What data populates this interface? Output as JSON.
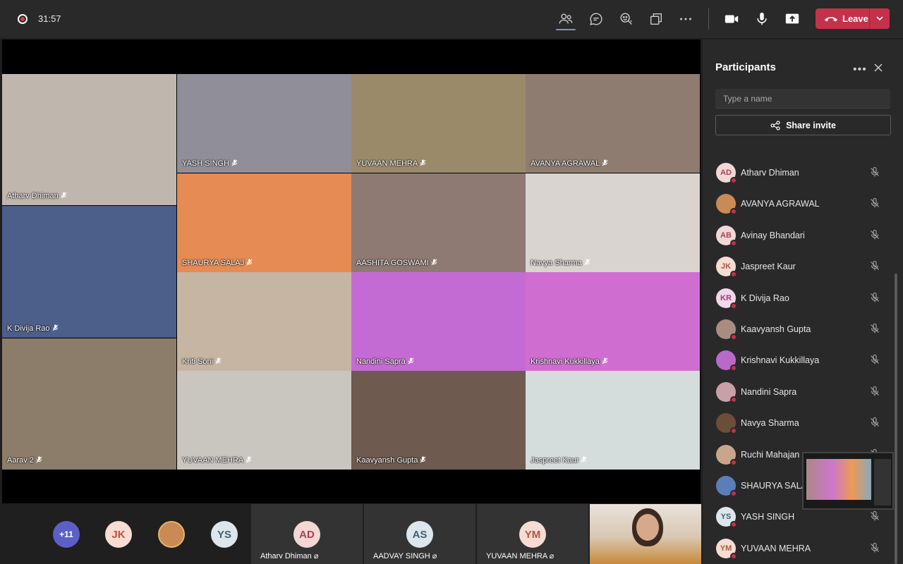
{
  "topbar": {
    "timer": "31:57",
    "leave_label": "Leave",
    "icons": [
      "people-icon",
      "chat-icon",
      "reactions-icon",
      "rooms-icon",
      "more-icon",
      "camera-icon",
      "mic-icon",
      "share-screen-icon"
    ]
  },
  "tiles": [
    {
      "name": "Atharv  Dhiman",
      "bg": "#bfb6ad"
    },
    {
      "name": "YASH SINGH",
      "bg": "#8f8e99"
    },
    {
      "name": "YUVAAN  MEHRA",
      "bg": "#9a8a6a"
    },
    {
      "name": "AVANYA  AGRAWAL",
      "bg": "#8f7c70"
    },
    {
      "name": "SHAURYA   SALAJ",
      "bg": "#e58b53"
    },
    {
      "name": "AASHITA   GOSWAMI",
      "bg": "#8e7a73"
    },
    {
      "name": "Navya  Sharma",
      "bg": "#d9d4cf"
    },
    {
      "name": "K Divija  Rao",
      "bg": "#4c5e8a"
    },
    {
      "name": "Kriti Soni",
      "bg": "#c7b5a3"
    },
    {
      "name": "Nandini  Sapra",
      "bg": "#c46bd3"
    },
    {
      "name": "Krishnavi  Kukkillaya",
      "bg": "#cf6ed0"
    },
    {
      "name": "Aarav 2",
      "bg": "#8c7c6a"
    },
    {
      "name": "YUVAAN  MEHRA",
      "bg": "#c9c6bf"
    },
    {
      "name": "Kaavyansh  Gupta",
      "bg": "#6e5a4e"
    },
    {
      "name": "Jaspreet  Kaur",
      "bg": "#d4dcdc"
    }
  ],
  "bottom": {
    "overflow_count": "+11",
    "avatars": [
      "JK",
      "YS"
    ],
    "tiles": [
      {
        "initials": "AD",
        "name": "Atharv Dhiman"
      },
      {
        "initials": "AS",
        "name": "AADVAY SINGH"
      },
      {
        "initials": "YM",
        "name": "YUVAAN MEHRA"
      }
    ]
  },
  "panel": {
    "title": "Participants",
    "search_placeholder": "Type a name",
    "share_label": "Share invite",
    "participants": [
      {
        "initials": "AD",
        "name": "Atharv Dhiman",
        "color": "#f2d7d5",
        "text": "#a94454"
      },
      {
        "initials": "",
        "name": "AVANYA AGRAWAL",
        "color": "#c98a55",
        "text": "#fff"
      },
      {
        "initials": "AB",
        "name": "Avinay Bhandari",
        "color": "#f2d7d5",
        "text": "#a94454"
      },
      {
        "initials": "JK",
        "name": "Jaspreet Kaur",
        "color": "#f6dcd1",
        "text": "#b5553f"
      },
      {
        "initials": "KR",
        "name": "K Divija Rao",
        "color": "#f2d7e8",
        "text": "#9b3d76"
      },
      {
        "initials": "",
        "name": "Kaavyansh Gupta",
        "color": "#a88c80",
        "text": "#fff"
      },
      {
        "initials": "",
        "name": "Krishnavi Kukkillaya",
        "color": "#b96ac9",
        "text": "#fff"
      },
      {
        "initials": "",
        "name": "Nandini Sapra",
        "color": "#c9a0a8",
        "text": "#fff"
      },
      {
        "initials": "",
        "name": "Navya Sharma",
        "color": "#6b4e3a",
        "text": "#fff"
      },
      {
        "initials": "",
        "name": "Ruchi Mahajan",
        "color": "#c9a68a",
        "text": "#fff"
      },
      {
        "initials": "",
        "name": "SHAURYA SALAJ",
        "color": "#5a7fb8",
        "text": "#fff"
      },
      {
        "initials": "YS",
        "name": "YASH SINGH",
        "color": "#dce6ec",
        "text": "#456070"
      },
      {
        "initials": "YM",
        "name": "YUVAAN MEHRA",
        "color": "#f6dcd1",
        "text": "#b5553f"
      }
    ]
  }
}
